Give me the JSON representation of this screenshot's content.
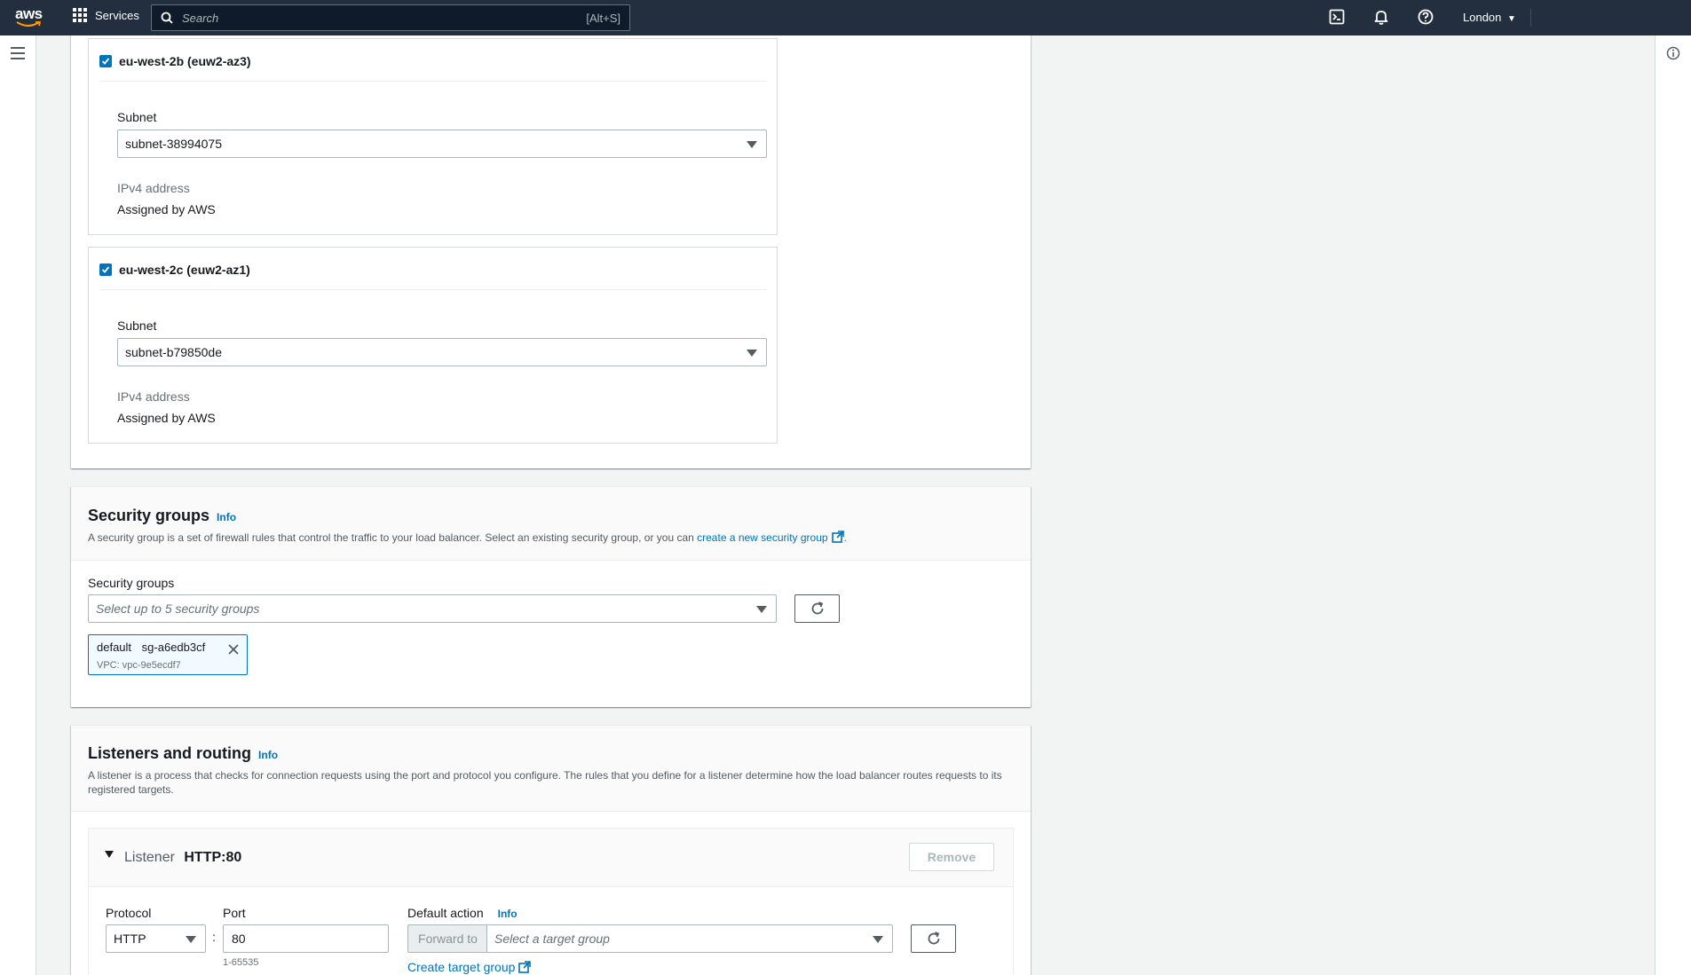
{
  "topnav": {
    "logo": "aws",
    "services_label": "Services",
    "search_placeholder": "Search",
    "search_shortcut": "[Alt+S]",
    "region": "London",
    "icons": [
      "cloudshell-icon",
      "notifications-icon",
      "help-icon"
    ]
  },
  "availability_zones": [
    {
      "name": "eu-west-2b (euw2-az3)",
      "checked": true,
      "subnet_label": "Subnet",
      "subnet_value": "subnet-38994075",
      "ipv4_label": "IPv4 address",
      "ipv4_value": "Assigned by AWS"
    },
    {
      "name": "eu-west-2c (euw2-az1)",
      "checked": true,
      "subnet_label": "Subnet",
      "subnet_value": "subnet-b79850de",
      "ipv4_label": "IPv4 address",
      "ipv4_value": "Assigned by AWS"
    }
  ],
  "security_groups": {
    "title": "Security groups",
    "info": "Info",
    "description_prefix": "A security group is a set of firewall rules that control the traffic to your load balancer. Select an existing security group, or you can ",
    "description_link": "create a new security group",
    "description_suffix": ".",
    "field_label": "Security groups",
    "placeholder": "Select up to 5 security groups",
    "token": {
      "name": "default",
      "id": "sg-a6edb3cf",
      "vpc": "VPC: vpc-9e5ecdf7"
    }
  },
  "listeners": {
    "title": "Listeners and routing",
    "info": "Info",
    "description": "A listener is a process that checks for connection requests using the port and protocol you configure. The rules that you define for a listener determine how the load balancer routes requests to its registered targets.",
    "listener": {
      "label": "Listener",
      "name": "HTTP:80",
      "remove_label": "Remove",
      "protocol_label": "Protocol",
      "protocol_value": "HTTP",
      "separator": ":",
      "port_label": "Port",
      "port_value": "80",
      "port_hint": "1-65535",
      "default_action_label": "Default action",
      "default_action_info": "Info",
      "forward_to": "Forward to",
      "target_group_placeholder": "Select a target group",
      "create_target_group": "Create target group"
    }
  },
  "colors": {
    "nav_bg": "#232f3e",
    "link": "#0073bb",
    "page_bg": "#f2f3f3"
  }
}
